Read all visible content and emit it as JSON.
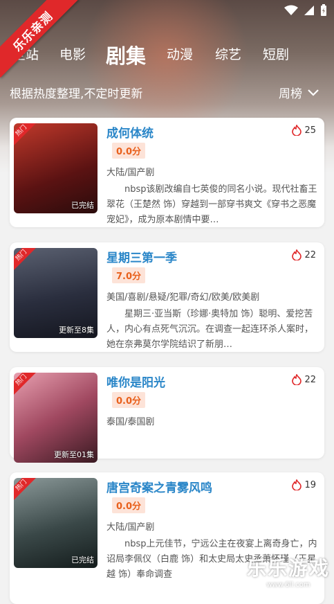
{
  "corner_banner": "乐乐亲测",
  "tabs": [
    {
      "label": "全站"
    },
    {
      "label": "电影"
    },
    {
      "label": "剧集"
    },
    {
      "label": "动漫"
    },
    {
      "label": "综艺"
    },
    {
      "label": "短剧"
    }
  ],
  "subbar": {
    "note": "根据热度整理,不定时更新",
    "rank_label": "周榜"
  },
  "items": [
    {
      "title": "成何体统",
      "heat": "25",
      "score": "0.0分",
      "genre": "大陆/国产剧",
      "desc": "nbsp该剧改编自七英俊的同名小说。现代社畜王翠花（王楚然 饰）穿越到一部穿书爽文《穿书之恶魔宠妃》，成为原本剧情中要…",
      "badge": "已完结",
      "hot": "热门",
      "poster_colors": [
        "#8a1e1e",
        "#3a1a1a"
      ]
    },
    {
      "title": "星期三第一季",
      "heat": "22",
      "score": "7.0分",
      "genre": "美国/喜剧/悬疑/犯罪/奇幻/欧美/欧美剧",
      "desc": "星期三·亚当斯（珍娜·奥特加 饰）聪明、爱挖苦人，内心有点死气沉沉。在调查一起连环杀人案时，她在奈弗莫尔学院结识了新朋…",
      "badge": "更新至8集",
      "hot": "热门",
      "poster_colors": [
        "#3a3f5a",
        "#1a1c2a"
      ]
    },
    {
      "title": "唯你是阳光",
      "heat": "22",
      "score": "0.0分",
      "genre": "泰国/泰国剧",
      "desc": "",
      "badge": "更新至01集",
      "hot": "热门",
      "poster_colors": [
        "#c8748a",
        "#4a2430"
      ]
    },
    {
      "title": "唐宫奇案之青雾风鸣",
      "heat": "19",
      "score": "0.0分",
      "genre": "大陆/国产剧",
      "desc": "nbsp上元佳节，宁远公主在夜宴上离奇身亡，内诏局李佩仪（白鹿 饰）和太史局太史丞萧怀瑾（王星越 饰）奉命调查",
      "badge": "已完结",
      "hot": "热门",
      "poster_colors": [
        "#6a7a7a",
        "#1e2a2a"
      ]
    }
  ],
  "watermark": {
    "text": "乐乐游戏",
    "url": "www.6ll.com"
  }
}
